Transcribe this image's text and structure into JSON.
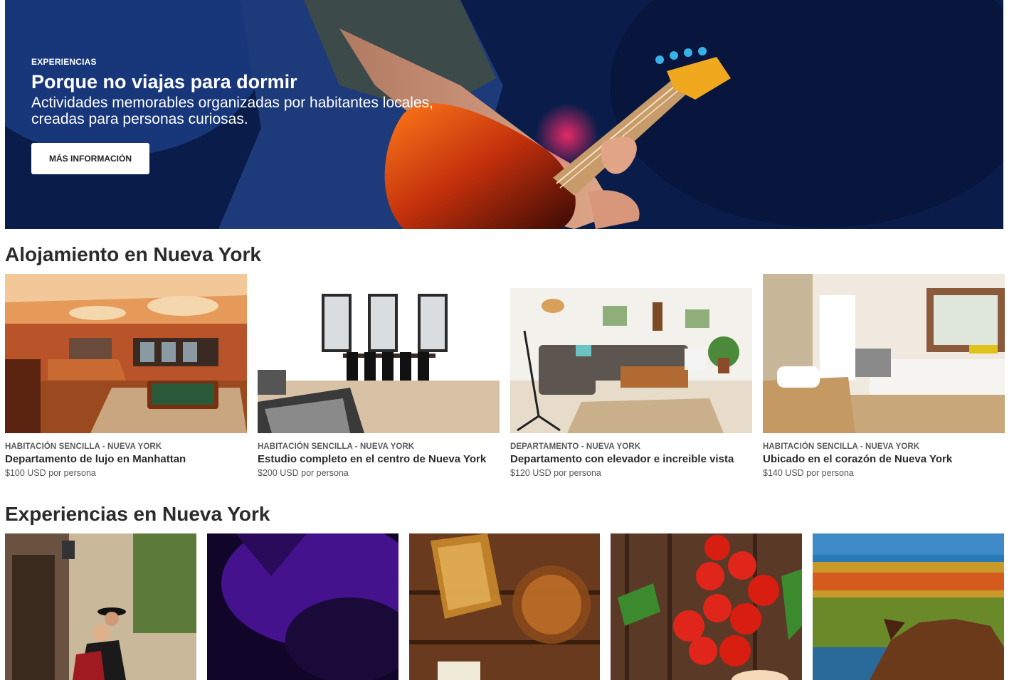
{
  "hero": {
    "kicker": "EXPERIENCIAS",
    "title": "Porque no viajas para dormir",
    "subtitle": "Actividades memorables organizadas por habitantes locales, creadas para personas curiosas.",
    "button_label": "MÁS INFORMACIÓN"
  },
  "stays": {
    "title": "Alojamiento en Nueva York",
    "items": [
      {
        "kicker": "HABITACIÓN SENCILLA - NUEVA YORK",
        "name": "Departamento de lujo en Manhattan",
        "price": "$100 USD por persona"
      },
      {
        "kicker": "HABITACIÓN SENCILLA - NUEVA YORK",
        "name": "Estudio completo en el centro de Nueva York",
        "price": "$200 USD por persona"
      },
      {
        "kicker": "DEPARTAMENTO - NUEVA YORK",
        "name": "Departamento con elevador e increible vista",
        "price": "$120 USD por persona"
      },
      {
        "kicker": "HABITACIÓN SENCILLA - NUEVA YORK",
        "name": "Ubicado en el corazón de Nueva York",
        "price": "$140 USD por persona"
      }
    ]
  },
  "experiences": {
    "title": "Experiencias en Nueva York"
  },
  "colors": {
    "hero_bg": "#0e2457",
    "heading_text": "#2b2b2b",
    "muted_text": "#555555"
  }
}
